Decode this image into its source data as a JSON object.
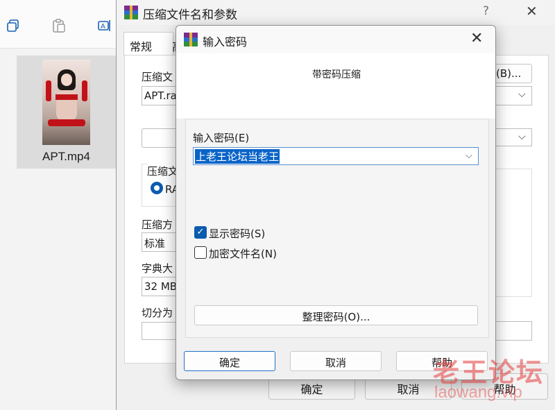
{
  "explorer": {
    "toolbar_icons": [
      "copy-icon",
      "paste-icon",
      "rename-icon"
    ],
    "file": {
      "name": "APT.mp4",
      "thumbnail": "video-thumbnail"
    }
  },
  "archive_dialog": {
    "title": "压缩文件名和参数",
    "help_glyph": "?",
    "close_glyph": "✕",
    "tabs": [
      "常规",
      "高"
    ],
    "archive_name_label": "压缩文",
    "archive_name_value": "APT.ra",
    "browse_label": "(B)...",
    "format_label": "压缩文",
    "format_value": "RA",
    "method_label": "压缩方",
    "method_value": "标准",
    "dict_label": "字典大",
    "dict_value": "32 MB",
    "split_label": "切分为",
    "ok_label": "确定",
    "cancel_label": "取消",
    "help_label": "帮助"
  },
  "password_dialog": {
    "title": "输入密码",
    "close_glyph": "✕",
    "subtitle": "带密码压缩",
    "password_label": "输入密码(E)",
    "password_value": "上老王论坛当老王",
    "show_password_label": "显示密码(S)",
    "show_password_checked": true,
    "encrypt_names_label": "加密文件名(N)",
    "encrypt_names_checked": false,
    "manage_label": "整理密码(O)...",
    "ok_label": "确定",
    "cancel_label": "取消",
    "help_label": "帮助"
  },
  "watermark": {
    "main": "老王论坛",
    "sub": "laowang.vip"
  },
  "colors": {
    "accent": "#0b5cad",
    "selection": "#0a64c8",
    "watermark": "#e63c3c"
  }
}
